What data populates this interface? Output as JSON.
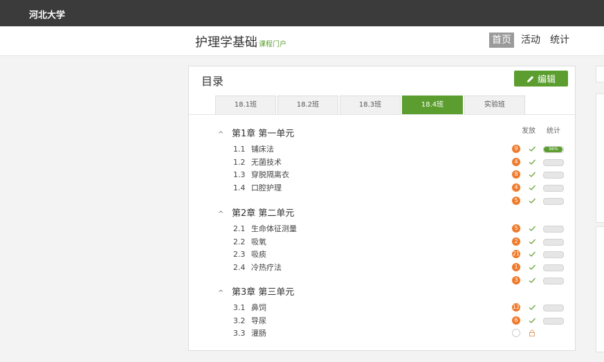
{
  "topbar": {
    "university": "河北大学"
  },
  "header": {
    "course_title": "护理学基础",
    "course_subtitle": "课程门户",
    "nav": [
      {
        "label": "首页",
        "active": true
      },
      {
        "label": "活动",
        "active": false
      },
      {
        "label": "统计",
        "active": false
      }
    ]
  },
  "catalog": {
    "title": "目录",
    "edit_label": "编辑",
    "tabs": [
      {
        "label": "18.1班",
        "active": false
      },
      {
        "label": "18.2班",
        "active": false
      },
      {
        "label": "18.3班",
        "active": false
      },
      {
        "label": "18.4班",
        "active": true
      },
      {
        "label": "实验班",
        "active": false
      }
    ],
    "col_publish": "发放",
    "col_stats": "统计",
    "chapters": [
      {
        "title": "第1章 第一单元",
        "lessons": [
          {
            "num": "1.1",
            "name": "铺床法",
            "badge": "9",
            "progress": 0.96,
            "progress_label": "96%"
          },
          {
            "num": "1.2",
            "name": "无菌技术",
            "badge": "4",
            "progress": 0
          },
          {
            "num": "1.3",
            "name": "穿脱隔离衣",
            "badge": "8",
            "progress": 0
          },
          {
            "num": "1.4",
            "name": "口腔护理",
            "badge": "4",
            "progress": 0
          },
          {
            "num": "",
            "name": "",
            "badge": "5",
            "progress": 0
          }
        ]
      },
      {
        "title": "第2章 第二单元",
        "lessons": [
          {
            "num": "2.1",
            "name": "生命体征测量",
            "badge": "5",
            "progress": 0
          },
          {
            "num": "2.2",
            "name": "吸氧",
            "badge": "2",
            "progress": 0
          },
          {
            "num": "2.3",
            "name": "吸痰",
            "badge": "21",
            "progress": 0
          },
          {
            "num": "2.4",
            "name": "冷热疗法",
            "badge": "1",
            "progress": 0
          },
          {
            "num": "",
            "name": "",
            "badge": "3",
            "progress": 0
          }
        ]
      },
      {
        "title": "第3章 第三单元",
        "lessons": [
          {
            "num": "3.1",
            "name": "鼻饲",
            "badge": "12",
            "progress": 0
          },
          {
            "num": "3.2",
            "name": "导尿",
            "badge": "6",
            "progress": 0
          },
          {
            "num": "3.3",
            "name": "灌肠",
            "badge": "",
            "progress": null,
            "locked": true
          }
        ]
      }
    ]
  },
  "colors": {
    "accent": "#5b9e2f",
    "badge": "#f07a2b",
    "topbar": "#3b3b3b"
  },
  "icons": {
    "edit": "pencil-icon",
    "collapse": "chevron-up-icon",
    "published": "check-icon",
    "locked": "lock-icon"
  }
}
